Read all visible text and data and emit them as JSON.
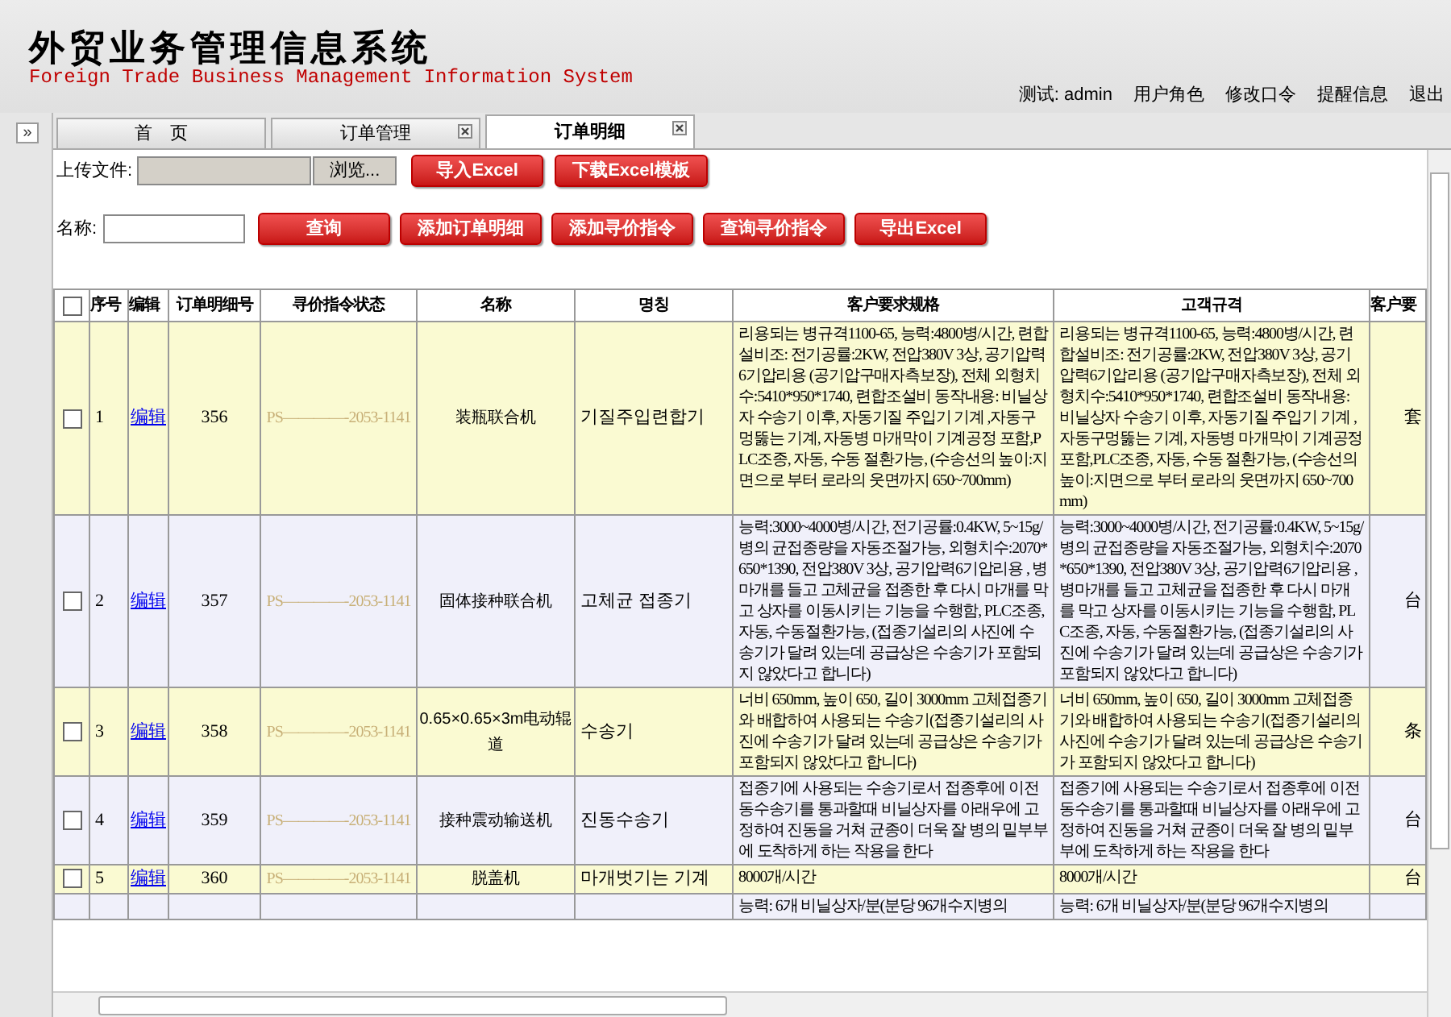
{
  "header": {
    "title": "外贸业务管理信息系统",
    "subtitle": "Foreign Trade Business Management Information System",
    "user_label": "测试:",
    "user": "admin",
    "links": [
      "用户角色",
      "修改口令",
      "提醒信息",
      "退出"
    ]
  },
  "sidebar_toggle": "»",
  "tabs": [
    {
      "label": "首　页",
      "selected": false,
      "closable": false
    },
    {
      "label": "订单管理",
      "selected": false,
      "closable": true
    },
    {
      "label": "订单明细",
      "selected": true,
      "closable": true
    }
  ],
  "upload": {
    "label": "上传文件:",
    "browse": "浏览...",
    "buttons": [
      "导入Excel",
      "下载Excel模板"
    ]
  },
  "search": {
    "label": "名称:",
    "buttons": [
      "查询",
      "添加订单明细",
      "添加寻价指令",
      "查询寻价指令",
      "导出Excel"
    ]
  },
  "table": {
    "all_checked": false,
    "columns": [
      "序号",
      "编辑",
      "订单明细号",
      "寻价指令状态",
      "名称",
      "명칭",
      "客户要求规格",
      "고객규격",
      "客户要"
    ],
    "rows": [
      {
        "checked": false,
        "no": "1",
        "edit": "编辑",
        "id": "356",
        "status": "PS————-2053-1141",
        "name": "装瓶联合机",
        "name_ko": "기질주입련합기",
        "spec": "리용되는 병규격1100-65, 능력:4800병/시간, 련합설비조: 전기공률:2KW, 전압380V 3상, 공기압력6기압리용 (공기압구매자측보장), 전체 외형치수:5410*950*1740, 련합조설비 동작내용: 비닐상자 수송기 이후, 자동기질 주입기 기계 ,자동구멍뚫는 기계, 자동병 마개막이 기계공정 포함,PLC조종, 자동, 수동 절환가능, (수송선의 높이:지면으로 부터 로라의 웃면까지 650~700mm)",
        "spec_ko": "리용되는 병규격1100-65, 능력:4800병/시간, 련합설비조: 전기공률:2KW, 전압380V 3상, 공기압력6기압리용 (공기압구매자측보장), 전체 외형치수:5410*950*1740, 련합조설비 동작내용: 비닐상자 수송기 이후, 자동기질 주입기 기계 ,자동구멍뚫는 기계, 자동병 마개막이 기계공정 포함,PLC조종, 자동, 수동 절환가능, (수송선의 높이:지면으로 부터 로라의 웃면까지 650~700mm)",
        "unit": "套"
      },
      {
        "checked": false,
        "no": "2",
        "edit": "编辑",
        "id": "357",
        "status": "PS————-2053-1141",
        "name": "固体接种联合机",
        "name_ko": "고체균 접종기",
        "spec": "능력:3000~4000병/시간, 전기공률:0.4KW, 5~15g/병의 균접종량을 자동조절가능, 외형치수:2070*650*1390, 전압380V 3상, 공기압력6기압리용 , 병마개를 들고 고체균을 접종한 후 다시 마개를 막고 상자를 이동시키는 기능을 수행함, PLC조종, 자동, 수동절환가능, (접종기설리의 사진에 수송기가 달려 있는데 공급상은 수송기가 포함되지 않았다고 합니다)",
        "spec_ko": "능력:3000~4000병/시간, 전기공률:0.4KW, 5~15g/병의 균접종량을 자동조절가능, 외형치수:2070*650*1390, 전압380V 3상, 공기압력6기압리용 , 병마개를 들고 고체균을 접종한 후 다시 마개를 막고 상자를 이동시키는 기능을 수행함, PLC조종, 자동, 수동절환가능, (접종기설리의 사진에 수송기가 달려 있는데 공급상은 수송기가 포함되지 않았다고 합니다)",
        "unit": "台"
      },
      {
        "checked": false,
        "no": "3",
        "edit": "编辑",
        "id": "358",
        "status": "PS————-2053-1141",
        "name": "0.65×0.65×3m电动辊道",
        "name_ko": "수송기",
        "spec": "너비 650mm, 높이 650, 길이 3000mm 고체접종기와 배합하여 사용되는 수송기(접종기설리의 사진에 수송기가 달려 있는데 공급상은 수송기가 포함되지 않았다고 합니다)",
        "spec_ko": "너비 650mm, 높이 650, 길이 3000mm 고체접종기와 배합하여 사용되는 수송기(접종기설리의 사진에 수송기가 달려 있는데 공급상은 수송기가 포함되지 않았다고 합니다)",
        "unit": "条"
      },
      {
        "checked": false,
        "no": "4",
        "edit": "编辑",
        "id": "359",
        "status": "PS————-2053-1141",
        "name": "接种震动输送机",
        "name_ko": "진동수송기",
        "spec": "접종기에 사용되는 수송기로서 접종후에 이전동수송기를 통과할때 비닐상자를 아래우에 고정하여 진동을 거쳐 균종이 더욱 잘 병의 밑부부에 도착하게 하는 작용을 한다",
        "spec_ko": "접종기에 사용되는 수송기로서 접종후에 이전동수송기를 통과할때 비닐상자를 아래우에 고정하여 진동을 거쳐 균종이 더욱 잘 병의 밑부부에 도착하게 하는 작용을 한다",
        "unit": "台"
      },
      {
        "checked": false,
        "no": "5",
        "edit": "编辑",
        "id": "360",
        "status": "PS————-2053-1141",
        "name": "脱盖机",
        "name_ko": "마개벗기는 기계",
        "spec": "8000개/시간",
        "spec_ko": "8000개/시간",
        "unit": "台"
      },
      {
        "spec": "능력: 6개 비닐상자/분(분당 96개수지병의",
        "spec_ko": "능력: 6개 비닐상자/분(분당 96개수지병의"
      }
    ]
  }
}
